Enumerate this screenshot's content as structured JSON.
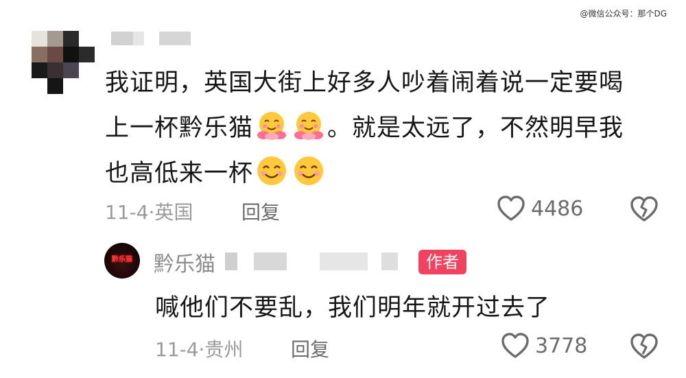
{
  "watermark": "@微信公众号：那个DG",
  "top_comment": {
    "text_line1": "我证明，英国大街上好多人吵着闹着说一定要喝",
    "text_line2a": "上一杯黔乐猫",
    "text_line2b": "。就是太远了，不然明早我",
    "text_line3": "也高低来一杯",
    "date": "11-4",
    "location": "英国",
    "reply_label": "回复",
    "likes": "4486",
    "emoji_names": [
      "hugging-face-icon",
      "smiling-face-icon"
    ]
  },
  "reply": {
    "author_name": "黔乐猫",
    "author_badge": "作者",
    "text": "喊他们不要乱，我们明年就开过去了",
    "date": "11-4",
    "location": "贵州",
    "reply_label": "回复",
    "likes": "3778"
  }
}
